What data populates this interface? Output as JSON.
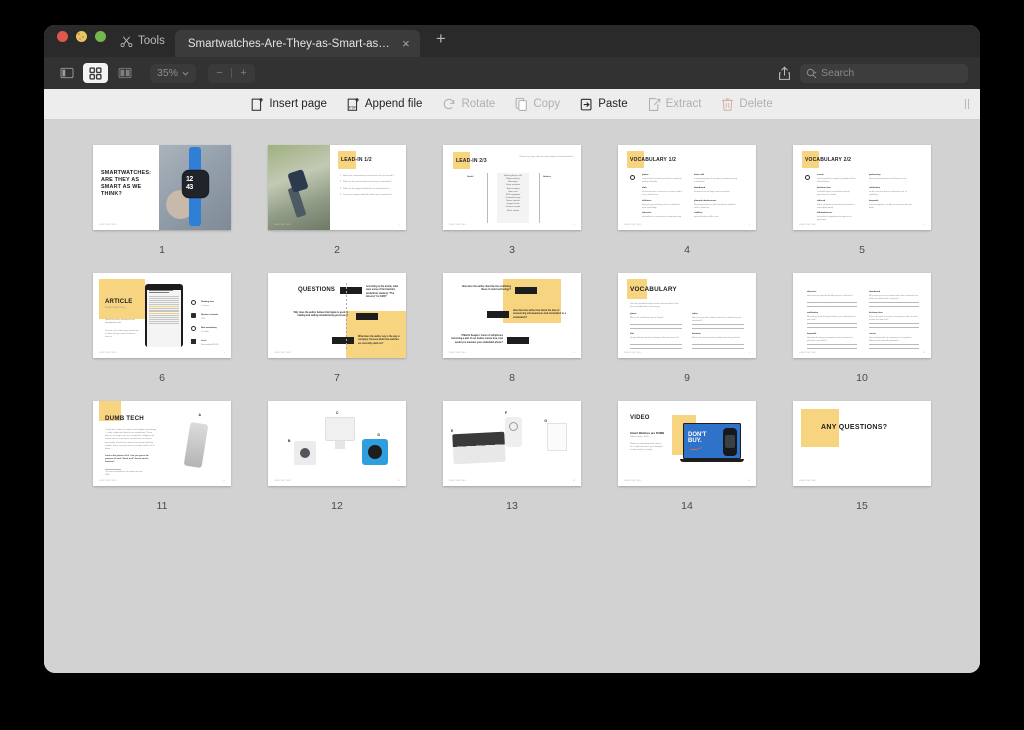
{
  "window": {
    "titlebar": {
      "tools_label": "Tools",
      "tab_title": "Smartwatches-Are-They-as-Smart-as-We-...",
      "close_glyph": "×",
      "newtab_glyph": "+"
    },
    "toolbar": {
      "zoom_value": "35%",
      "zoom_out_glyph": "−",
      "zoom_in_glyph": "+",
      "search_placeholder": "Search"
    },
    "actionbar": {
      "items": [
        {
          "label": "Insert page",
          "icon": "insert-page-icon",
          "disabled": false
        },
        {
          "label": "Append file",
          "icon": "append-file-icon",
          "disabled": false
        },
        {
          "label": "Rotate",
          "icon": "rotate-icon",
          "disabled": true
        },
        {
          "label": "Copy",
          "icon": "copy-icon",
          "disabled": true
        },
        {
          "label": "Paste",
          "icon": "paste-icon",
          "disabled": false
        },
        {
          "label": "Extract",
          "icon": "extract-icon",
          "disabled": true
        },
        {
          "label": "Delete",
          "icon": "delete-icon",
          "disabled": true
        }
      ]
    }
  },
  "colors": {
    "accent_yellow": "#f7d480",
    "window_chrome": "#2a2a2a",
    "canvas_bg": "#d2d2d2",
    "actionbar_bg": "#ededed",
    "slide_blue": "#2f72c9"
  },
  "pages": [
    {
      "number": "1",
      "title": "SMARTWATCHES: ARE THEY AS SMART AS WE THINK?",
      "footer": "SMARTWATCHES",
      "kind": "title-photo"
    },
    {
      "number": "2",
      "title": "LEAD-IN 1/2",
      "footer": "SMARTWATCHES",
      "kind": "photo-list"
    },
    {
      "number": "3",
      "title": "LEAD-IN 2/3",
      "footer": "SMARTWATCHES",
      "kind": "two-column-sort",
      "col_left": "Useful",
      "col_right": "Useless",
      "note": "Please say if you with not action features of smartwatches"
    },
    {
      "number": "4",
      "title": "VOCABULARY 1/2",
      "footer": "SMARTWATCHES",
      "kind": "vocab-two-col"
    },
    {
      "number": "5",
      "title": "VOCABULARY 2/2",
      "footer": "SMARTWATCHES",
      "kind": "vocab-two-col"
    },
    {
      "number": "6",
      "title": "ARTICLE",
      "subtitle": "SMARTWATCHES",
      "footer": "SMARTWATCHES",
      "kind": "article",
      "stats": [
        "Reading time",
        "Number of words",
        "New vocabulary",
        "Level"
      ]
    },
    {
      "number": "7",
      "title": "QUESTIONS",
      "footer": "SMARTWATCHES",
      "kind": "questions"
    },
    {
      "number": "8",
      "title": "",
      "footer": "SMARTWATCHES",
      "kind": "questions2"
    },
    {
      "number": "9",
      "title": "VOCABULARY",
      "footer": "SMARTWATCHES",
      "kind": "vocab-lines"
    },
    {
      "number": "10",
      "title": "",
      "footer": "SMARTWATCHES",
      "kind": "vocab-lines2"
    },
    {
      "number": "11",
      "title": "DUMB TECH",
      "footer": "SMARTWATCHES",
      "kind": "dumb-tech",
      "label_a": "A"
    },
    {
      "number": "12",
      "title": "",
      "footer": "SMARTWATCHES",
      "kind": "devices-bcd",
      "label_b": "B",
      "label_c": "C",
      "label_d": "D"
    },
    {
      "number": "13",
      "title": "",
      "footer": "SMARTWATCHES",
      "kind": "devices-efg",
      "label_e": "E",
      "label_f": "F",
      "label_g": "G"
    },
    {
      "number": "14",
      "title": "VIDEO",
      "footer": "SMARTWATCHES",
      "kind": "video",
      "video_title": "Smart Watches are DUMB",
      "video_meta": "Video Duration: 10:18",
      "screen_line1": "DON'T",
      "screen_line2": "BUY."
    },
    {
      "number": "15",
      "title": "ANY QUESTIONS?",
      "footer": "SMARTWATCHES",
      "kind": "closing"
    }
  ]
}
